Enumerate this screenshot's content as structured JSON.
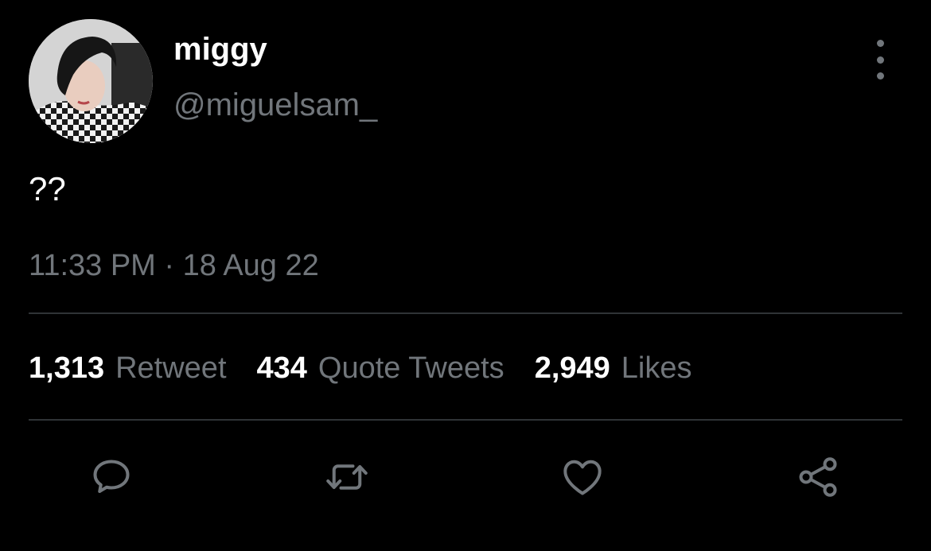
{
  "user": {
    "display_name": "miggy",
    "handle": "@miguelsam_",
    "avatar_icon": "profile-photo"
  },
  "tweet": {
    "text": "??",
    "timestamp": "11:33 PM · 18 Aug 22"
  },
  "stats": [
    {
      "count": "1,313",
      "label": "Retweet"
    },
    {
      "count": "434",
      "label": "Quote Tweets"
    },
    {
      "count": "2,949",
      "label": "Likes"
    }
  ],
  "actions": {
    "reply_icon": "speech-bubble-icon",
    "retweet_icon": "retweet-icon",
    "like_icon": "heart-icon",
    "share_icon": "share-icon"
  },
  "colors": {
    "background": "#000000",
    "primary_text": "#ffffff",
    "secondary_text": "#71767b",
    "divider": "#2f3336"
  }
}
